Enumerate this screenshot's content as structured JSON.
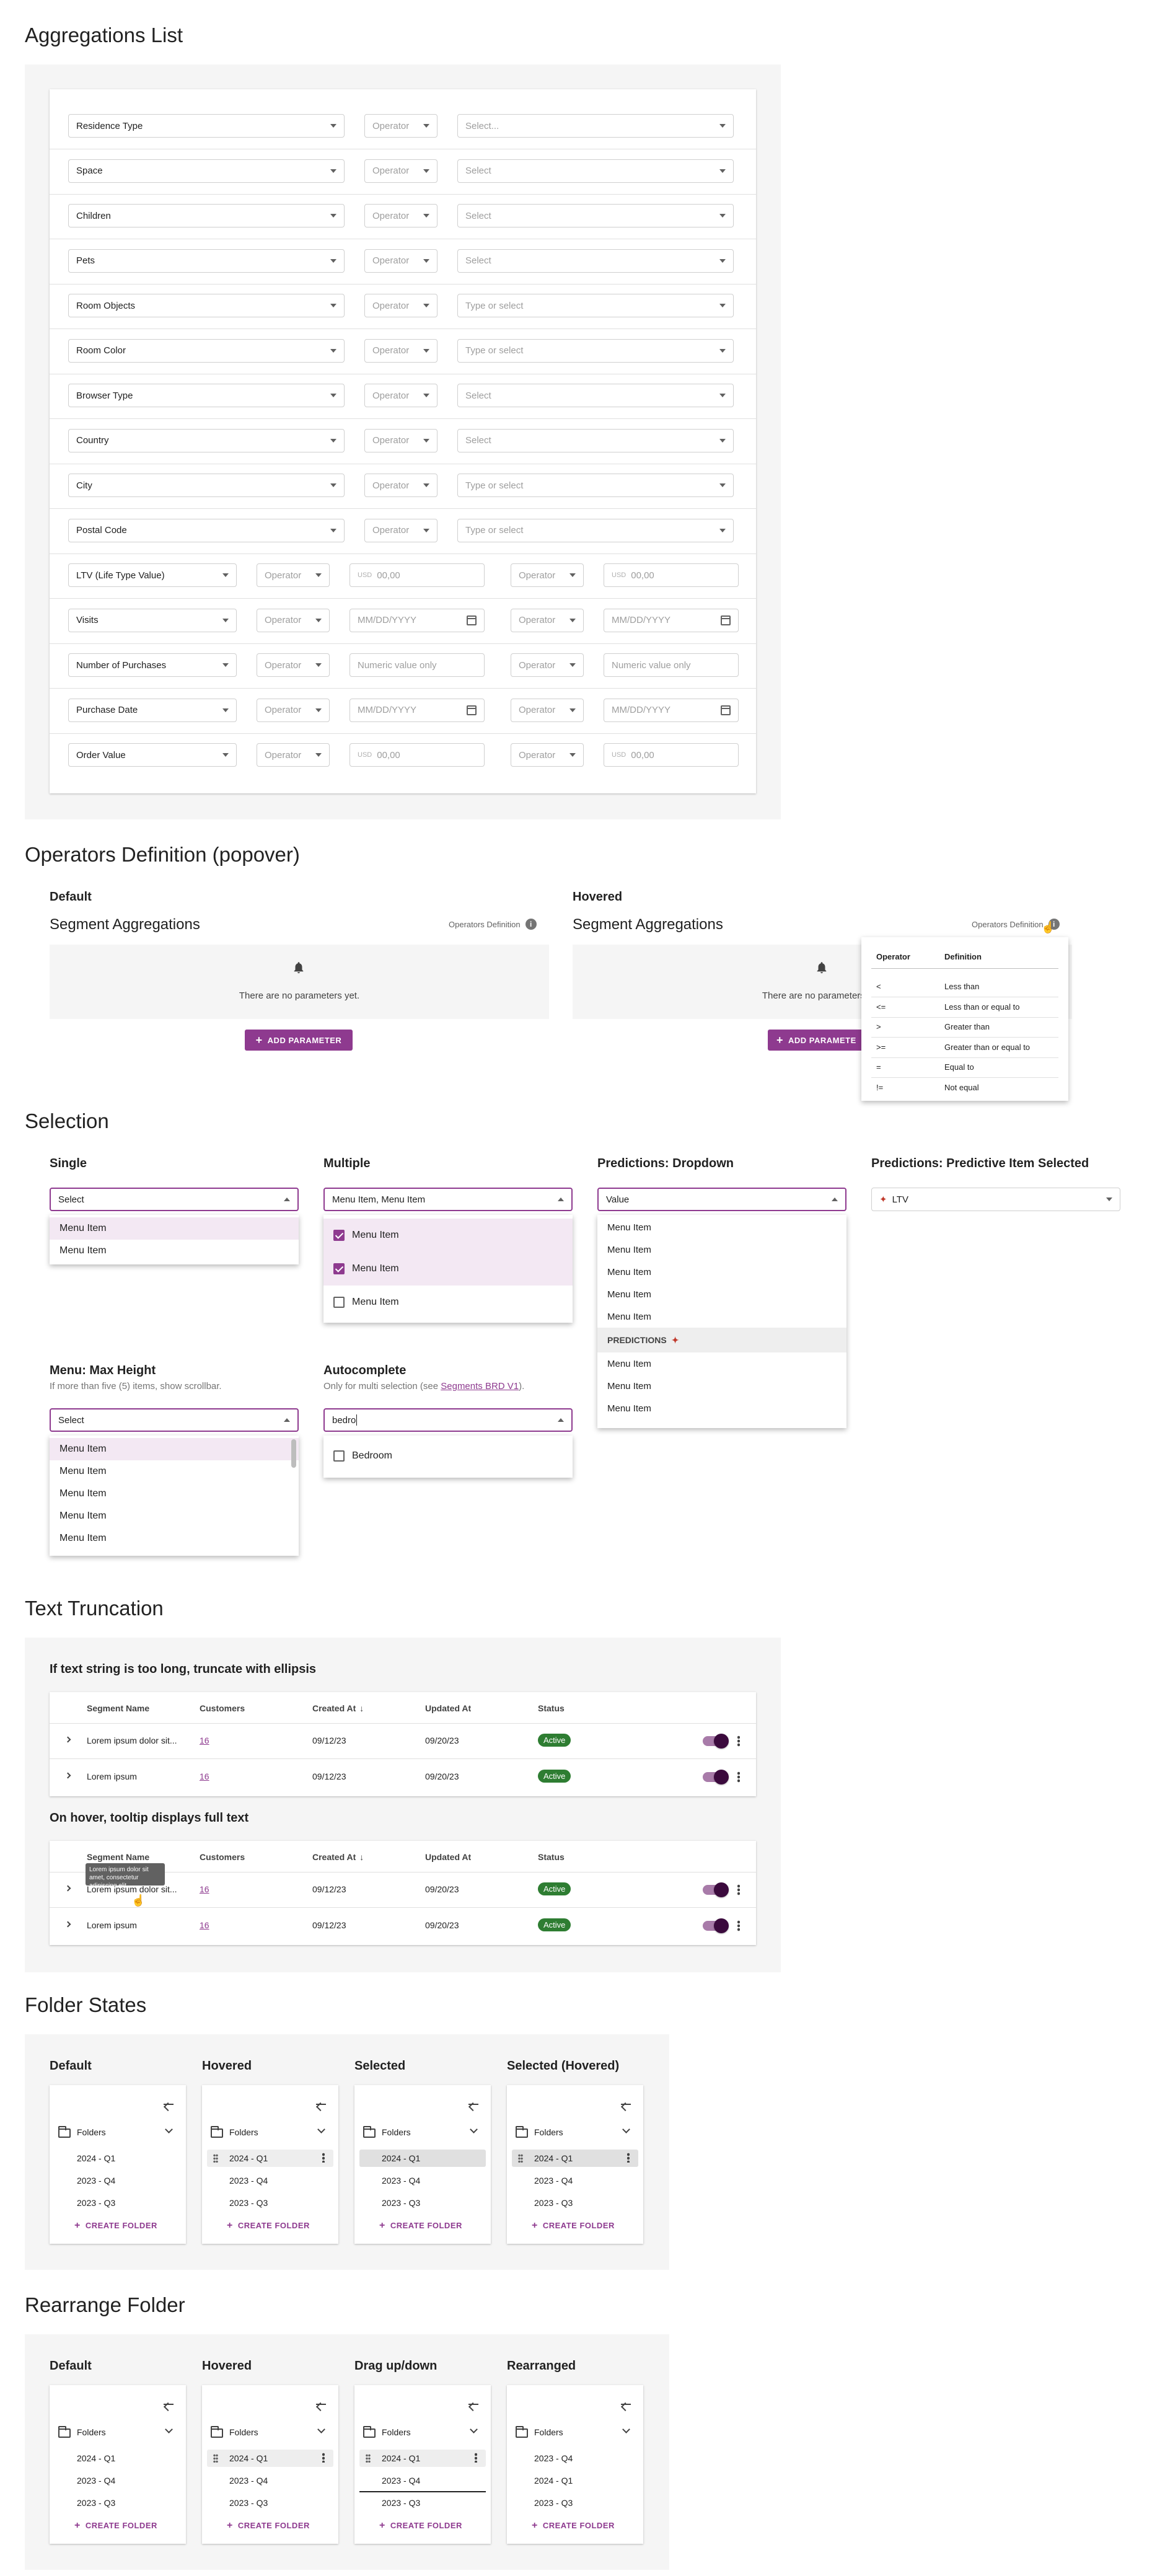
{
  "colors": {
    "accent": "#8e3a8f",
    "active": "#2e7d32",
    "bg_panel": "#f5f5f5"
  },
  "sections": {
    "aggregations": "Aggregations List",
    "operators": "Operators Definition (popover)",
    "selection": "Selection",
    "truncation": "Text Truncation",
    "folders": "Folder States",
    "rearrange": "Rearrange Folder"
  },
  "agg": {
    "rows3": [
      {
        "field": "Residence Type",
        "op": "Operator",
        "value": "Select..."
      },
      {
        "field": "Space",
        "op": "Operator",
        "value": "Select"
      },
      {
        "field": "Children",
        "op": "Operator",
        "value": "Select"
      },
      {
        "field": "Pets",
        "op": "Operator",
        "value": "Select"
      },
      {
        "field": "Room Objects",
        "op": "Operator",
        "value": "Type or select"
      },
      {
        "field": "Room Color",
        "op": "Operator",
        "value": "Type or select"
      },
      {
        "field": "Browser Type",
        "op": "Operator",
        "value": "Select"
      },
      {
        "field": "Country",
        "op": "Operator",
        "value": "Select"
      },
      {
        "field": "City",
        "op": "Operator",
        "value": "Type or select"
      },
      {
        "field": "Postal Code",
        "op": "Operator",
        "value": "Type or select"
      }
    ],
    "rows5": [
      {
        "field": "LTV (Life Type Value)",
        "op": "Operator",
        "v1": "00,00",
        "v2": "00,00",
        "kind": "usd"
      },
      {
        "field": "Visits",
        "op": "Operator",
        "v1": "MM/DD/YYYY",
        "v2": "MM/DD/YYYY",
        "kind": "date"
      },
      {
        "field": "Number of Purchases",
        "op": "Operator",
        "v1": "Numeric value only",
        "v2": "Numeric value only",
        "kind": "num"
      },
      {
        "field": "Purchase Date",
        "op": "Operator",
        "v1": "MM/DD/YYYY",
        "v2": "MM/DD/YYYY",
        "kind": "date"
      },
      {
        "field": "Order Value",
        "op": "Operator",
        "v1": "00,00",
        "v2": "00,00",
        "kind": "usd"
      }
    ],
    "usd": "USD"
  },
  "ops": {
    "default_label": "Default",
    "hovered_label": "Hovered",
    "title": "Segment Aggregations",
    "link": "Operators Definition",
    "info": "i",
    "empty": "There are no parameters yet.",
    "add": "ADD PARAMETER",
    "add_trunc": "ADD PARAMETE",
    "col_op": "Operator",
    "col_def": "Definition",
    "table": [
      {
        "op": "<",
        "def": "Less than"
      },
      {
        "op": "<=",
        "def": "Less than or equal to"
      },
      {
        "op": ">",
        "def": "Greater than"
      },
      {
        "op": ">=",
        "def": "Greater than or equal to"
      },
      {
        "op": "=",
        "def": "Equal to"
      },
      {
        "op": "!=",
        "def": "Not equal"
      }
    ]
  },
  "sel": {
    "single": {
      "label": "Single",
      "value": "Select",
      "items": [
        "Menu Item",
        "Menu Item"
      ]
    },
    "multiple": {
      "label": "Multiple",
      "value": "Menu Item, Menu Item",
      "items": [
        {
          "t": "Menu Item",
          "on": true
        },
        {
          "t": "Menu Item",
          "on": true
        },
        {
          "t": "Menu Item",
          "on": false
        }
      ]
    },
    "pred": {
      "label": "Predictions: Dropdown",
      "value": "Value",
      "items_top": [
        "Menu Item",
        "Menu Item",
        "Menu Item",
        "Menu Item",
        "Menu Item"
      ],
      "group": "PREDICTIONS",
      "items_bot": [
        "Menu Item",
        "Menu Item",
        "Menu Item"
      ]
    },
    "predsel": {
      "label": "Predictions: Predictive Item Selected",
      "value": "LTV"
    },
    "maxh": {
      "label": "Menu: Max Height",
      "desc": "If more than five (5) items, show scrollbar.",
      "value": "Select",
      "items": [
        "Menu Item",
        "Menu Item",
        "Menu Item",
        "Menu Item",
        "Menu Item"
      ]
    },
    "auto": {
      "label": "Autocomplete",
      "desc_pre": "Only for multi selection (see ",
      "desc_link": "Segments BRD V1",
      "desc_post": ").",
      "value": "bedro",
      "items": [
        "Bedroom"
      ]
    }
  },
  "trunc": {
    "h1": "If text string is too long, truncate with ellipsis",
    "h2": "On hover, tooltip displays full text",
    "cols": [
      "Segment Name",
      "Customers",
      "Created At",
      "Updated At",
      "Status"
    ],
    "sort": "↓",
    "rows": [
      {
        "name": "Lorem ipsum dolor sit...",
        "cust": "16",
        "created": "09/12/23",
        "updated": "09/20/23",
        "status": "Active"
      },
      {
        "name": "Lorem ipsum",
        "cust": "16",
        "created": "09/12/23",
        "updated": "09/20/23",
        "status": "Active"
      }
    ],
    "tooltip": "Lorem ipsum dolor sit amet, consectetur adipiscing elit"
  },
  "folders": {
    "states": [
      "Default",
      "Hovered",
      "Selected",
      "Selected (Hovered)"
    ],
    "re_states": [
      "Default",
      "Hovered",
      "Drag up/down",
      "Rearranged"
    ],
    "title": "Folders",
    "items": [
      "2024 - Q1",
      "2023 - Q4",
      "2023 - Q3"
    ],
    "re_items": [
      "2023 - Q4",
      "2024 - Q1",
      "2023 - Q3"
    ],
    "create": "CREATE FOLDER"
  }
}
